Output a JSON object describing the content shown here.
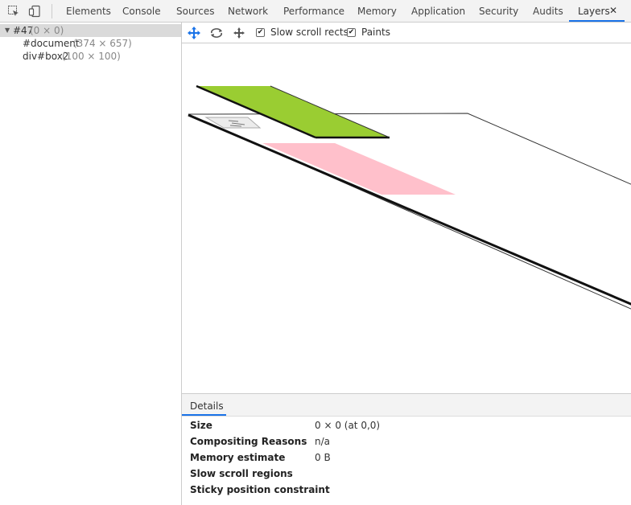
{
  "tabs": [
    {
      "label": "Elements"
    },
    {
      "label": "Console"
    },
    {
      "label": "Sources"
    },
    {
      "label": "Network"
    },
    {
      "label": "Performance"
    },
    {
      "label": "Memory"
    },
    {
      "label": "Application"
    },
    {
      "label": "Security"
    },
    {
      "label": "Audits"
    },
    {
      "label": "Layers"
    }
  ],
  "active_tab": "Layers",
  "tab_close": "✕",
  "layer_tree": [
    {
      "name": "#47",
      "size": "(0 × 0)",
      "selected": true
    },
    {
      "name": "#document",
      "size": "(374 × 657)",
      "selected": false
    },
    {
      "name": "div#box2",
      "size": "(100 × 100)",
      "selected": false
    }
  ],
  "toolbar": {
    "slow_scroll_label": "Slow scroll rects",
    "slow_scroll_checked": true,
    "paints_label": "Paints",
    "paints_checked": true
  },
  "canvas": {
    "green_layer_color": "#9acd32",
    "pink_layer_color": "#ffc0cb"
  },
  "details": {
    "tab_label": "Details",
    "rows": [
      {
        "key": "Size",
        "value": "0 × 0 (at 0,0)"
      },
      {
        "key": "Compositing Reasons",
        "value": "n/a"
      },
      {
        "key": "Memory estimate",
        "value": "0 B"
      },
      {
        "key": "Slow scroll regions",
        "value": ""
      },
      {
        "key": "Sticky position constraint",
        "value": ""
      }
    ]
  },
  "colors": {
    "accent": "#1a73e8",
    "selected_row": "#dadada"
  }
}
